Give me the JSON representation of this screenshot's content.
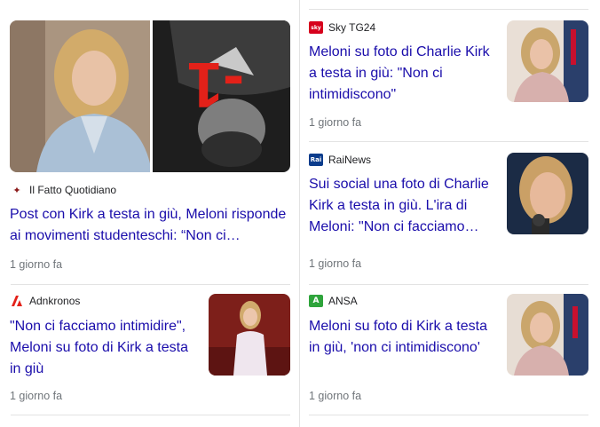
{
  "colors": {
    "title": "#1a0dab",
    "meta": "#70757a",
    "divider": "#e3e3e3",
    "minus_one": "#e32119"
  },
  "hero": {
    "source": "Il Fatto Quotidiano",
    "source_icon": "il-fatto-quotidiano-logo",
    "title": "Post con Kirk a testa in giù, Meloni risponde ai movimenti studenteschi: “Non ci…",
    "time": "1 giorno fa",
    "overlay_text": "-1"
  },
  "cards": [
    {
      "id": "skytg24",
      "source": "Sky TG24",
      "source_icon": "sky-tg24-logo",
      "logo_text": "sky",
      "title": "Meloni su foto di Charlie Kirk a testa in giù: \"Non ci intimidiscono\"",
      "time": "1 giorno fa"
    },
    {
      "id": "rainews",
      "source": "RaiNews",
      "source_icon": "rainews-logo",
      "logo_text": "Rai",
      "title": "Sui social una foto di Charlie Kirk a testa in giù. L'ira di Meloni: \"Non ci facciamo…",
      "time": "1 giorno fa"
    },
    {
      "id": "adnkronos",
      "source": "Adnkronos",
      "source_icon": "adnkronos-logo",
      "logo_text": "",
      "title": "\"Non ci facciamo intimidire\", Meloni su foto di Kirk a testa in giù",
      "time": "1 giorno fa"
    },
    {
      "id": "ansa",
      "source": "ANSA",
      "source_icon": "ansa-logo",
      "logo_text": "A",
      "title": "Meloni su foto di Kirk a testa in giù, 'non ci intimidiscono'",
      "time": "1 giorno fa"
    }
  ]
}
